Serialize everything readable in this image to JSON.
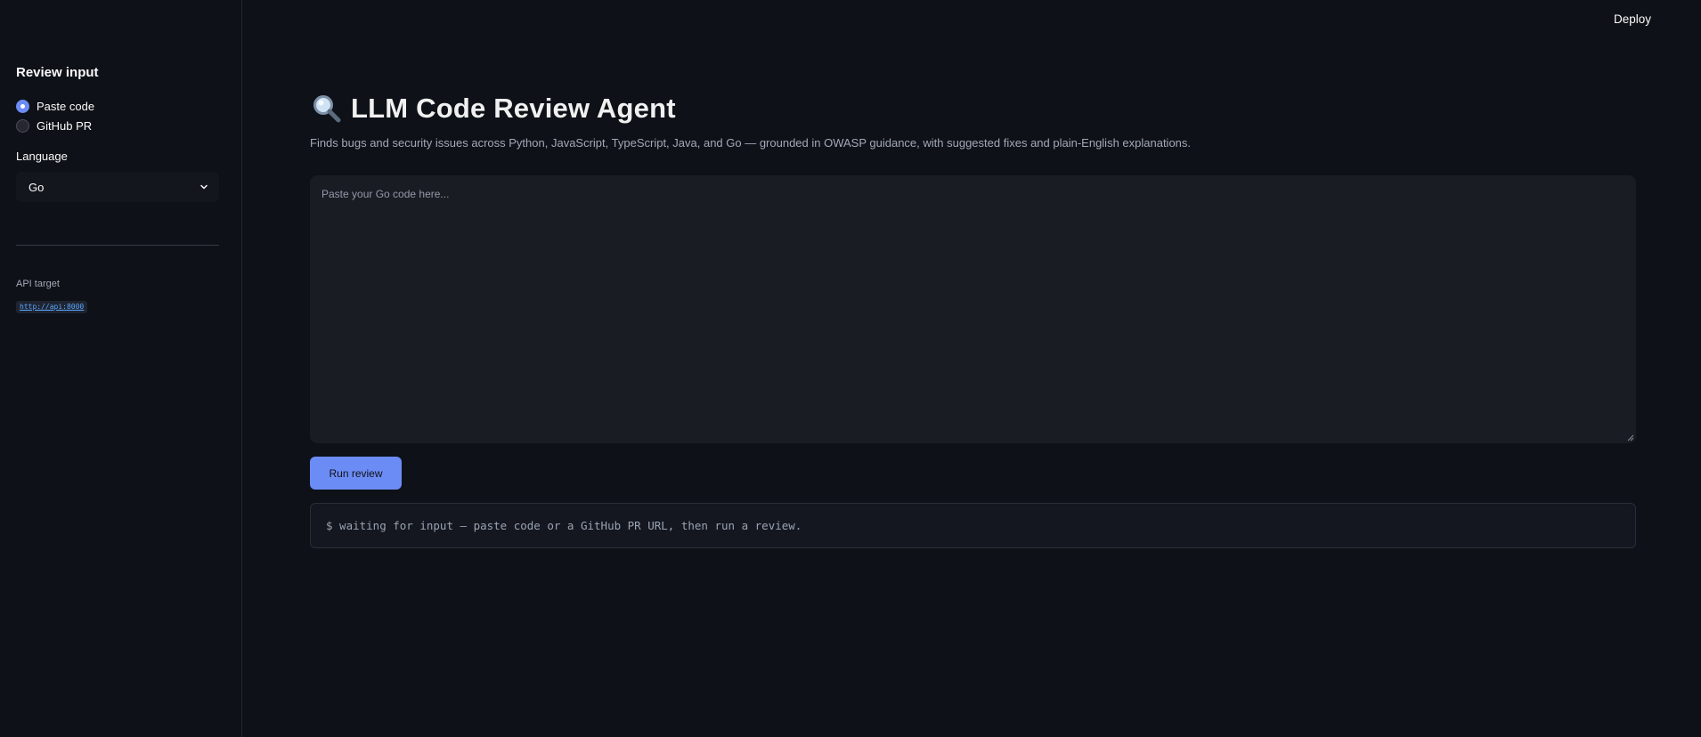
{
  "header": {
    "deploy_label": "Deploy"
  },
  "sidebar": {
    "heading": "Review input",
    "radio_options": [
      {
        "label": "Paste code",
        "selected": true
      },
      {
        "label": "GitHub PR",
        "selected": false
      }
    ],
    "language_label": "Language",
    "language_value": "Go",
    "api_caption": "API target",
    "api_url": "http://api:8000"
  },
  "main": {
    "title_icon": "magnifying-glass-icon",
    "title": "LLM Code Review Agent",
    "subtitle": "Finds bugs and security issues across Python, JavaScript, TypeScript, Java, and Go — grounded in OWASP guidance, with suggested fixes and plain-English explanations.",
    "code_placeholder": "Paste your Go code here...",
    "run_button_label": "Run review",
    "terminal_text": "$ waiting for input — paste code or a GitHub PR URL, then run a review."
  },
  "colors": {
    "background": "#0e1117",
    "accent": "#6c8cf5",
    "input_bg": "#1a1c24"
  }
}
